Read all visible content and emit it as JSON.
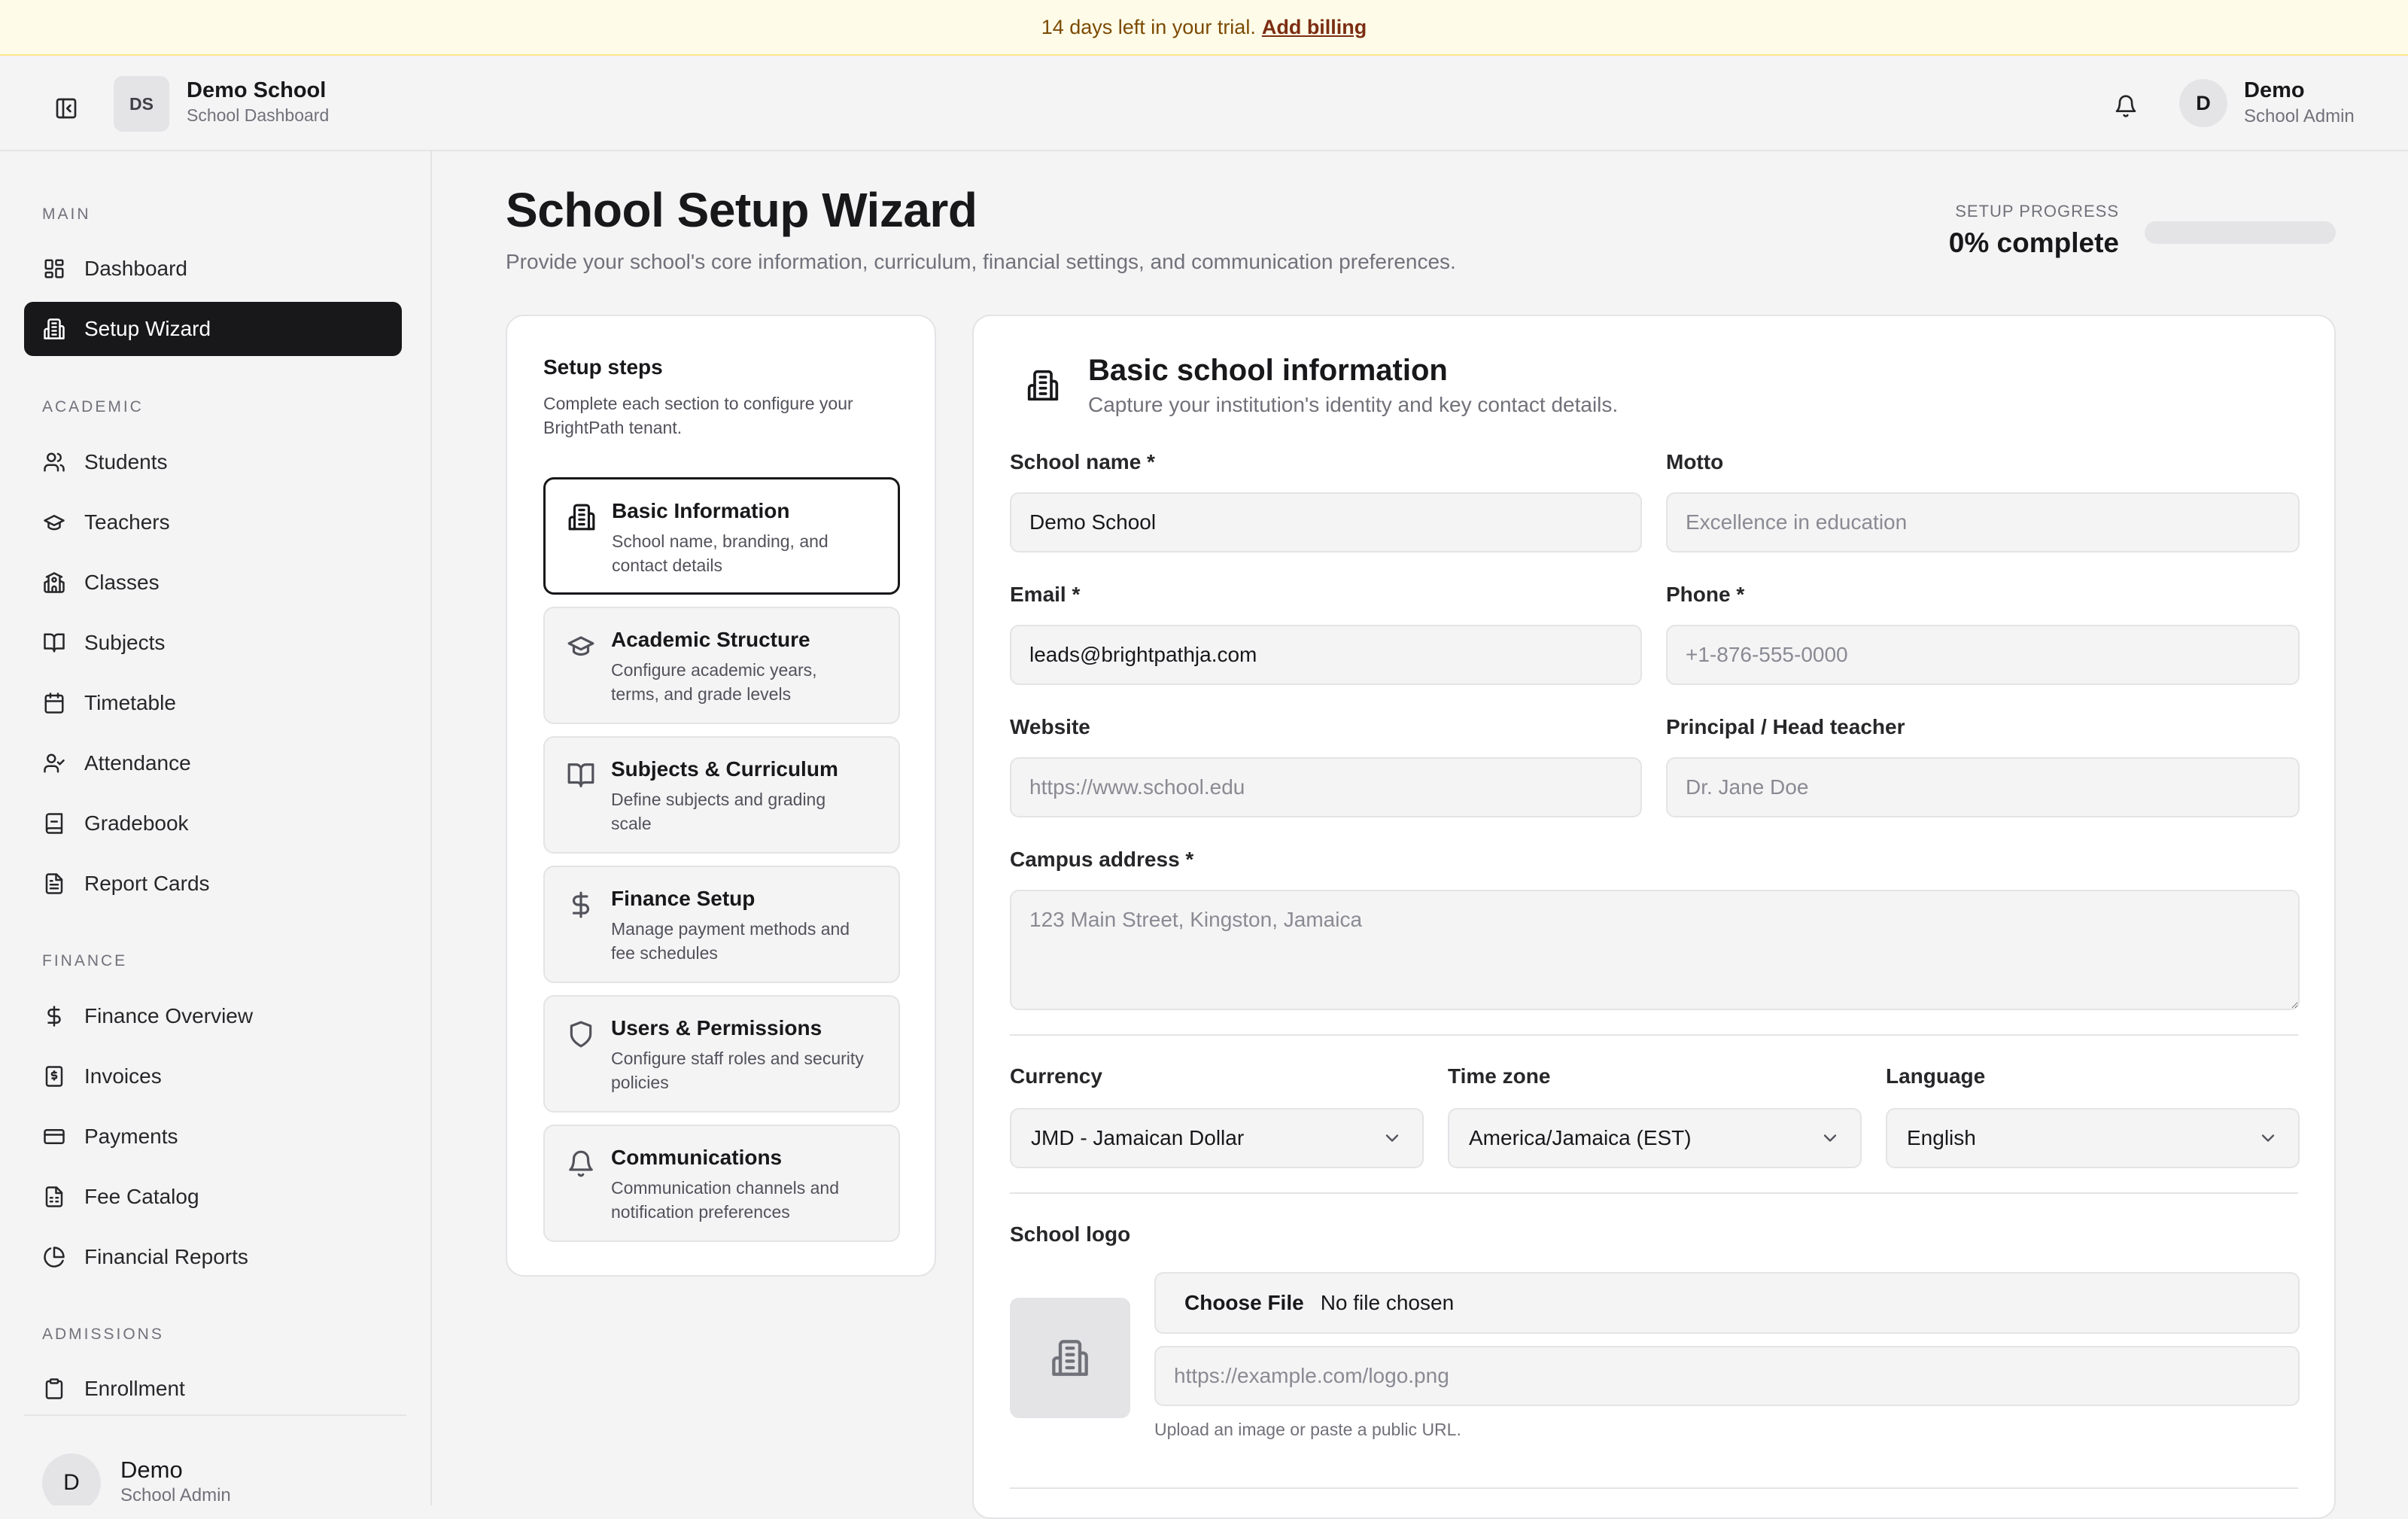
{
  "banner": {
    "text": "14 days left in your trial.",
    "link": "Add billing"
  },
  "header": {
    "org_initials": "DS",
    "org_name": "Demo School",
    "org_sub": "School Dashboard",
    "user_initial": "D",
    "user_name": "Demo",
    "user_role": "School Admin"
  },
  "sidebar": {
    "sections": [
      {
        "label": "MAIN",
        "items": [
          {
            "label": "Dashboard",
            "icon": "dashboard-icon"
          },
          {
            "label": "Setup Wizard",
            "icon": "building-icon",
            "active": true
          }
        ]
      },
      {
        "label": "ACADEMIC",
        "items": [
          {
            "label": "Students",
            "icon": "users-icon"
          },
          {
            "label": "Teachers",
            "icon": "graduation-cap-icon"
          },
          {
            "label": "Classes",
            "icon": "school-icon"
          },
          {
            "label": "Subjects",
            "icon": "book-open-icon"
          },
          {
            "label": "Timetable",
            "icon": "calendar-icon"
          },
          {
            "label": "Attendance",
            "icon": "user-check-icon"
          },
          {
            "label": "Gradebook",
            "icon": "notebook-icon"
          },
          {
            "label": "Report Cards",
            "icon": "file-text-icon"
          }
        ]
      },
      {
        "label": "FINANCE",
        "items": [
          {
            "label": "Finance Overview",
            "icon": "dollar-icon"
          },
          {
            "label": "Invoices",
            "icon": "invoice-icon"
          },
          {
            "label": "Payments",
            "icon": "credit-card-icon"
          },
          {
            "label": "Fee Catalog",
            "icon": "file-spreadsheet-icon"
          },
          {
            "label": "Financial Reports",
            "icon": "pie-chart-icon"
          }
        ]
      },
      {
        "label": "ADMISSIONS",
        "items": [
          {
            "label": "Enrollment",
            "icon": "clipboard-icon"
          }
        ]
      }
    ],
    "footer": {
      "initial": "D",
      "name": "Demo",
      "role": "School Admin"
    }
  },
  "page": {
    "title": "School Setup Wizard",
    "subtitle": "Provide your school's core information, curriculum, financial settings, and communication preferences.",
    "progress_label": "SETUP PROGRESS",
    "progress_value": "0% complete",
    "progress_fraction": 0
  },
  "steps": {
    "title": "Setup steps",
    "description": "Complete each section to configure your BrightPath tenant.",
    "items": [
      {
        "title": "Basic Information",
        "desc": "School name, branding, and contact details",
        "icon": "building-icon",
        "active": true
      },
      {
        "title": "Academic Structure",
        "desc": "Configure academic years, terms, and grade levels",
        "icon": "graduation-cap-icon"
      },
      {
        "title": "Subjects & Curriculum",
        "desc": "Define subjects and grading scale",
        "icon": "book-open-icon"
      },
      {
        "title": "Finance Setup",
        "desc": "Manage payment methods and fee schedules",
        "icon": "dollar-icon"
      },
      {
        "title": "Users & Permissions",
        "desc": "Configure staff roles and security policies",
        "icon": "shield-icon"
      },
      {
        "title": "Communications",
        "desc": "Communication channels and notification preferences",
        "icon": "bell-icon"
      }
    ]
  },
  "form": {
    "title": "Basic school information",
    "subtitle": "Capture your institution's identity and key contact details.",
    "school_name": {
      "label": "School name *",
      "value": "Demo School"
    },
    "motto": {
      "label": "Motto",
      "placeholder": "Excellence in education"
    },
    "email": {
      "label": "Email *",
      "value": "leads@brightpathja.com"
    },
    "phone": {
      "label": "Phone *",
      "placeholder": "+1-876-555-0000"
    },
    "website": {
      "label": "Website",
      "placeholder": "https://www.school.edu"
    },
    "principal": {
      "label": "Principal / Head teacher",
      "placeholder": "Dr. Jane Doe"
    },
    "address": {
      "label": "Campus address *",
      "placeholder": "123 Main Street, Kingston, Jamaica"
    },
    "currency": {
      "label": "Currency",
      "value": "JMD - Jamaican Dollar"
    },
    "timezone": {
      "label": "Time zone",
      "value": "America/Jamaica (EST)"
    },
    "language": {
      "label": "Language",
      "value": "English"
    },
    "logo": {
      "label": "School logo",
      "choose": "Choose File",
      "no_file": "No file chosen",
      "url_placeholder": "https://example.com/logo.png",
      "hint": "Upload an image or paste a public URL."
    }
  }
}
